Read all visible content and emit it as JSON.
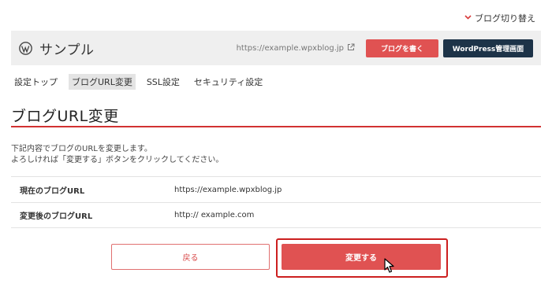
{
  "header": {
    "blog_switch_label": "ブログ切り替え",
    "site_name": "サンプル",
    "site_url": "https://example.wpxblog.jp",
    "write_button_label": "ブログを書く",
    "admin_button_label": "WordPress管理画面"
  },
  "tabs": [
    {
      "label": "設定トップ"
    },
    {
      "label": "ブログURL変更",
      "active": true
    },
    {
      "label": "SSL設定"
    },
    {
      "label": "セキュリティ設定"
    }
  ],
  "main": {
    "title": "ブログURL変更",
    "description_line1": "下記内容でブログのURLを変更します。",
    "description_line2": "よろしければ「変更する」ボタンをクリックしてください。",
    "rows": [
      {
        "label": "現在のブログURL",
        "value": "https://example.wpxblog.jp"
      },
      {
        "label": "変更後のブログURL",
        "value": "http:// example.com"
      }
    ],
    "back_button_label": "戻る",
    "change_button_label": "変更する"
  },
  "colors": {
    "accent_red": "#e05252",
    "title_rule": "#d23131",
    "admin_navy": "#1d3348",
    "highlight": "#cc1f1f"
  },
  "icons": [
    "chevron-down-icon",
    "wordpress-logo-icon",
    "external-link-icon",
    "mouse-cursor-icon"
  ]
}
